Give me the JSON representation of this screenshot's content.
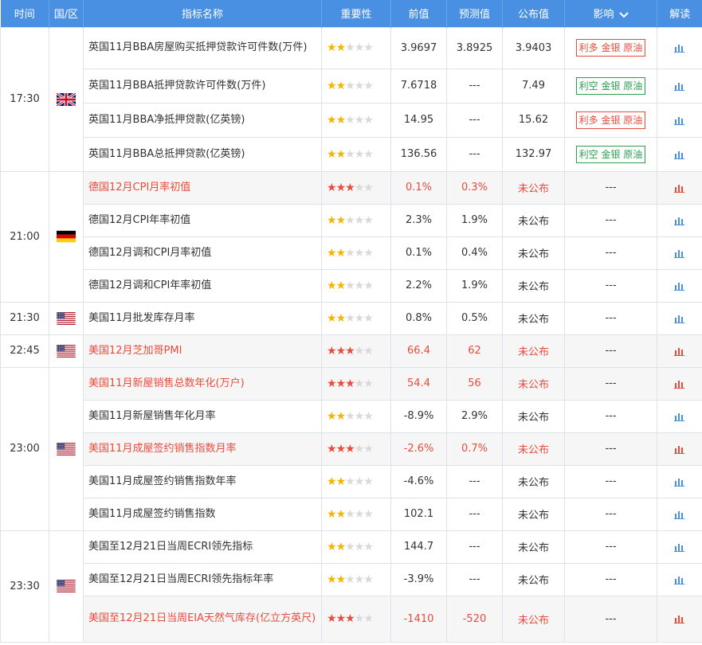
{
  "header": {
    "time": "时间",
    "region": "国/区",
    "name": "指标名称",
    "importance": "重要性",
    "previous": "前值",
    "forecast": "预测值",
    "actual": "公布值",
    "impact": "影响",
    "analysis": "解读"
  },
  "colors": {
    "header_bg": "#4a90e2",
    "highlight": "#e84c3d",
    "bullish": "#e84c3d",
    "bearish": "#2e9e4f",
    "star": "#f5b400",
    "chart_icon": "#4a90e2"
  },
  "groups": [
    {
      "time": "17:30",
      "flag": "uk-flag-icon",
      "rows": [
        {
          "name": "英国11月BBA房屋购买抵押贷款许可件数(万件)",
          "stars": 2,
          "prev": "3.9697",
          "forecast": "3.8925",
          "actual": "3.9403",
          "impact": "利多 金银 原油",
          "impact_type": "bull",
          "highlight": false,
          "h": 52
        },
        {
          "name": "英国11月BBA抵押贷款许可件数(万件)",
          "stars": 2,
          "prev": "7.6718",
          "forecast": "---",
          "actual": "7.49",
          "impact": "利空 金银 原油",
          "impact_type": "bear",
          "highlight": false,
          "h": 43
        },
        {
          "name": "英国11月BBA净抵押贷款(亿英镑)",
          "stars": 2,
          "prev": "14.95",
          "forecast": "---",
          "actual": "15.62",
          "impact": "利多 金银 原油",
          "impact_type": "bull",
          "highlight": false,
          "h": 43
        },
        {
          "name": "英国11月BBA总抵押贷款(亿英镑)",
          "stars": 2,
          "prev": "136.56",
          "forecast": "---",
          "actual": "132.97",
          "impact": "利空 金银 原油",
          "impact_type": "bear",
          "highlight": false,
          "h": 43
        }
      ]
    },
    {
      "time": "21:00",
      "flag": "germany-flag-icon",
      "rows": [
        {
          "name": "德国12月CPI月率初值",
          "stars": 3,
          "prev": "0.1%",
          "forecast": "0.3%",
          "actual": "未公布",
          "impact": "---",
          "impact_type": "none",
          "highlight": true,
          "h": 41
        },
        {
          "name": "德国12月CPI年率初值",
          "stars": 2,
          "prev": "2.3%",
          "forecast": "1.9%",
          "actual": "未公布",
          "impact": "---",
          "impact_type": "none",
          "highlight": false,
          "h": 41
        },
        {
          "name": "德国12月调和CPI月率初值",
          "stars": 2,
          "prev": "0.1%",
          "forecast": "0.4%",
          "actual": "未公布",
          "impact": "---",
          "impact_type": "none",
          "highlight": false,
          "h": 41
        },
        {
          "name": "德国12月调和CPI年率初值",
          "stars": 2,
          "prev": "2.2%",
          "forecast": "1.9%",
          "actual": "未公布",
          "impact": "---",
          "impact_type": "none",
          "highlight": false,
          "h": 41
        }
      ]
    },
    {
      "time": "21:30",
      "flag": "usa-flag-icon",
      "rows": [
        {
          "name": "美国11月批发库存月率",
          "stars": 2,
          "prev": "0.8%",
          "forecast": "0.5%",
          "actual": "未公布",
          "impact": "---",
          "impact_type": "none",
          "highlight": false,
          "h": 41
        }
      ]
    },
    {
      "time": "22:45",
      "flag": "usa-flag-icon",
      "rows": [
        {
          "name": "美国12月芝加哥PMI",
          "stars": 3,
          "prev": "66.4",
          "forecast": "62",
          "actual": "未公布",
          "impact": "---",
          "impact_type": "none",
          "highlight": true,
          "h": 41
        }
      ]
    },
    {
      "time": "23:00",
      "flag": "usa-flag-icon",
      "rows": [
        {
          "name": "美国11月新屋销售总数年化(万户)",
          "stars": 3,
          "prev": "54.4",
          "forecast": "56",
          "actual": "未公布",
          "impact": "---",
          "impact_type": "none",
          "highlight": true,
          "h": 41
        },
        {
          "name": "美国11月新屋销售年化月率",
          "stars": 2,
          "prev": "-8.9%",
          "forecast": "2.9%",
          "actual": "未公布",
          "impact": "---",
          "impact_type": "none",
          "highlight": false,
          "h": 41
        },
        {
          "name": "美国11月成屋签约销售指数月率",
          "stars": 3,
          "prev": "-2.6%",
          "forecast": "0.7%",
          "actual": "未公布",
          "impact": "---",
          "impact_type": "none",
          "highlight": true,
          "h": 41
        },
        {
          "name": "美国11月成屋签约销售指数年率",
          "stars": 2,
          "prev": "-4.6%",
          "forecast": "---",
          "actual": "未公布",
          "impact": "---",
          "impact_type": "none",
          "highlight": false,
          "h": 41
        },
        {
          "name": "美国11月成屋签约销售指数",
          "stars": 2,
          "prev": "102.1",
          "forecast": "---",
          "actual": "未公布",
          "impact": "---",
          "impact_type": "none",
          "highlight": false,
          "h": 41
        }
      ]
    },
    {
      "time": "23:30",
      "flag": "usa-flag-icon",
      "rows": [
        {
          "name": "美国至12月21日当周ECRI领先指标",
          "stars": 2,
          "prev": "144.7",
          "forecast": "---",
          "actual": "未公布",
          "impact": "---",
          "impact_type": "none",
          "highlight": false,
          "h": 41
        },
        {
          "name": "美国至12月21日当周ECRI领先指标年率",
          "stars": 2,
          "prev": "-3.9%",
          "forecast": "---",
          "actual": "未公布",
          "impact": "---",
          "impact_type": "none",
          "highlight": false,
          "h": 41
        },
        {
          "name": "美国至12月21日当周EIA天然气库存(亿立方英尺)",
          "stars": 3,
          "prev": "-1410",
          "forecast": "-520",
          "actual": "未公布",
          "impact": "---",
          "impact_type": "none",
          "highlight": true,
          "h": 58
        }
      ]
    }
  ]
}
